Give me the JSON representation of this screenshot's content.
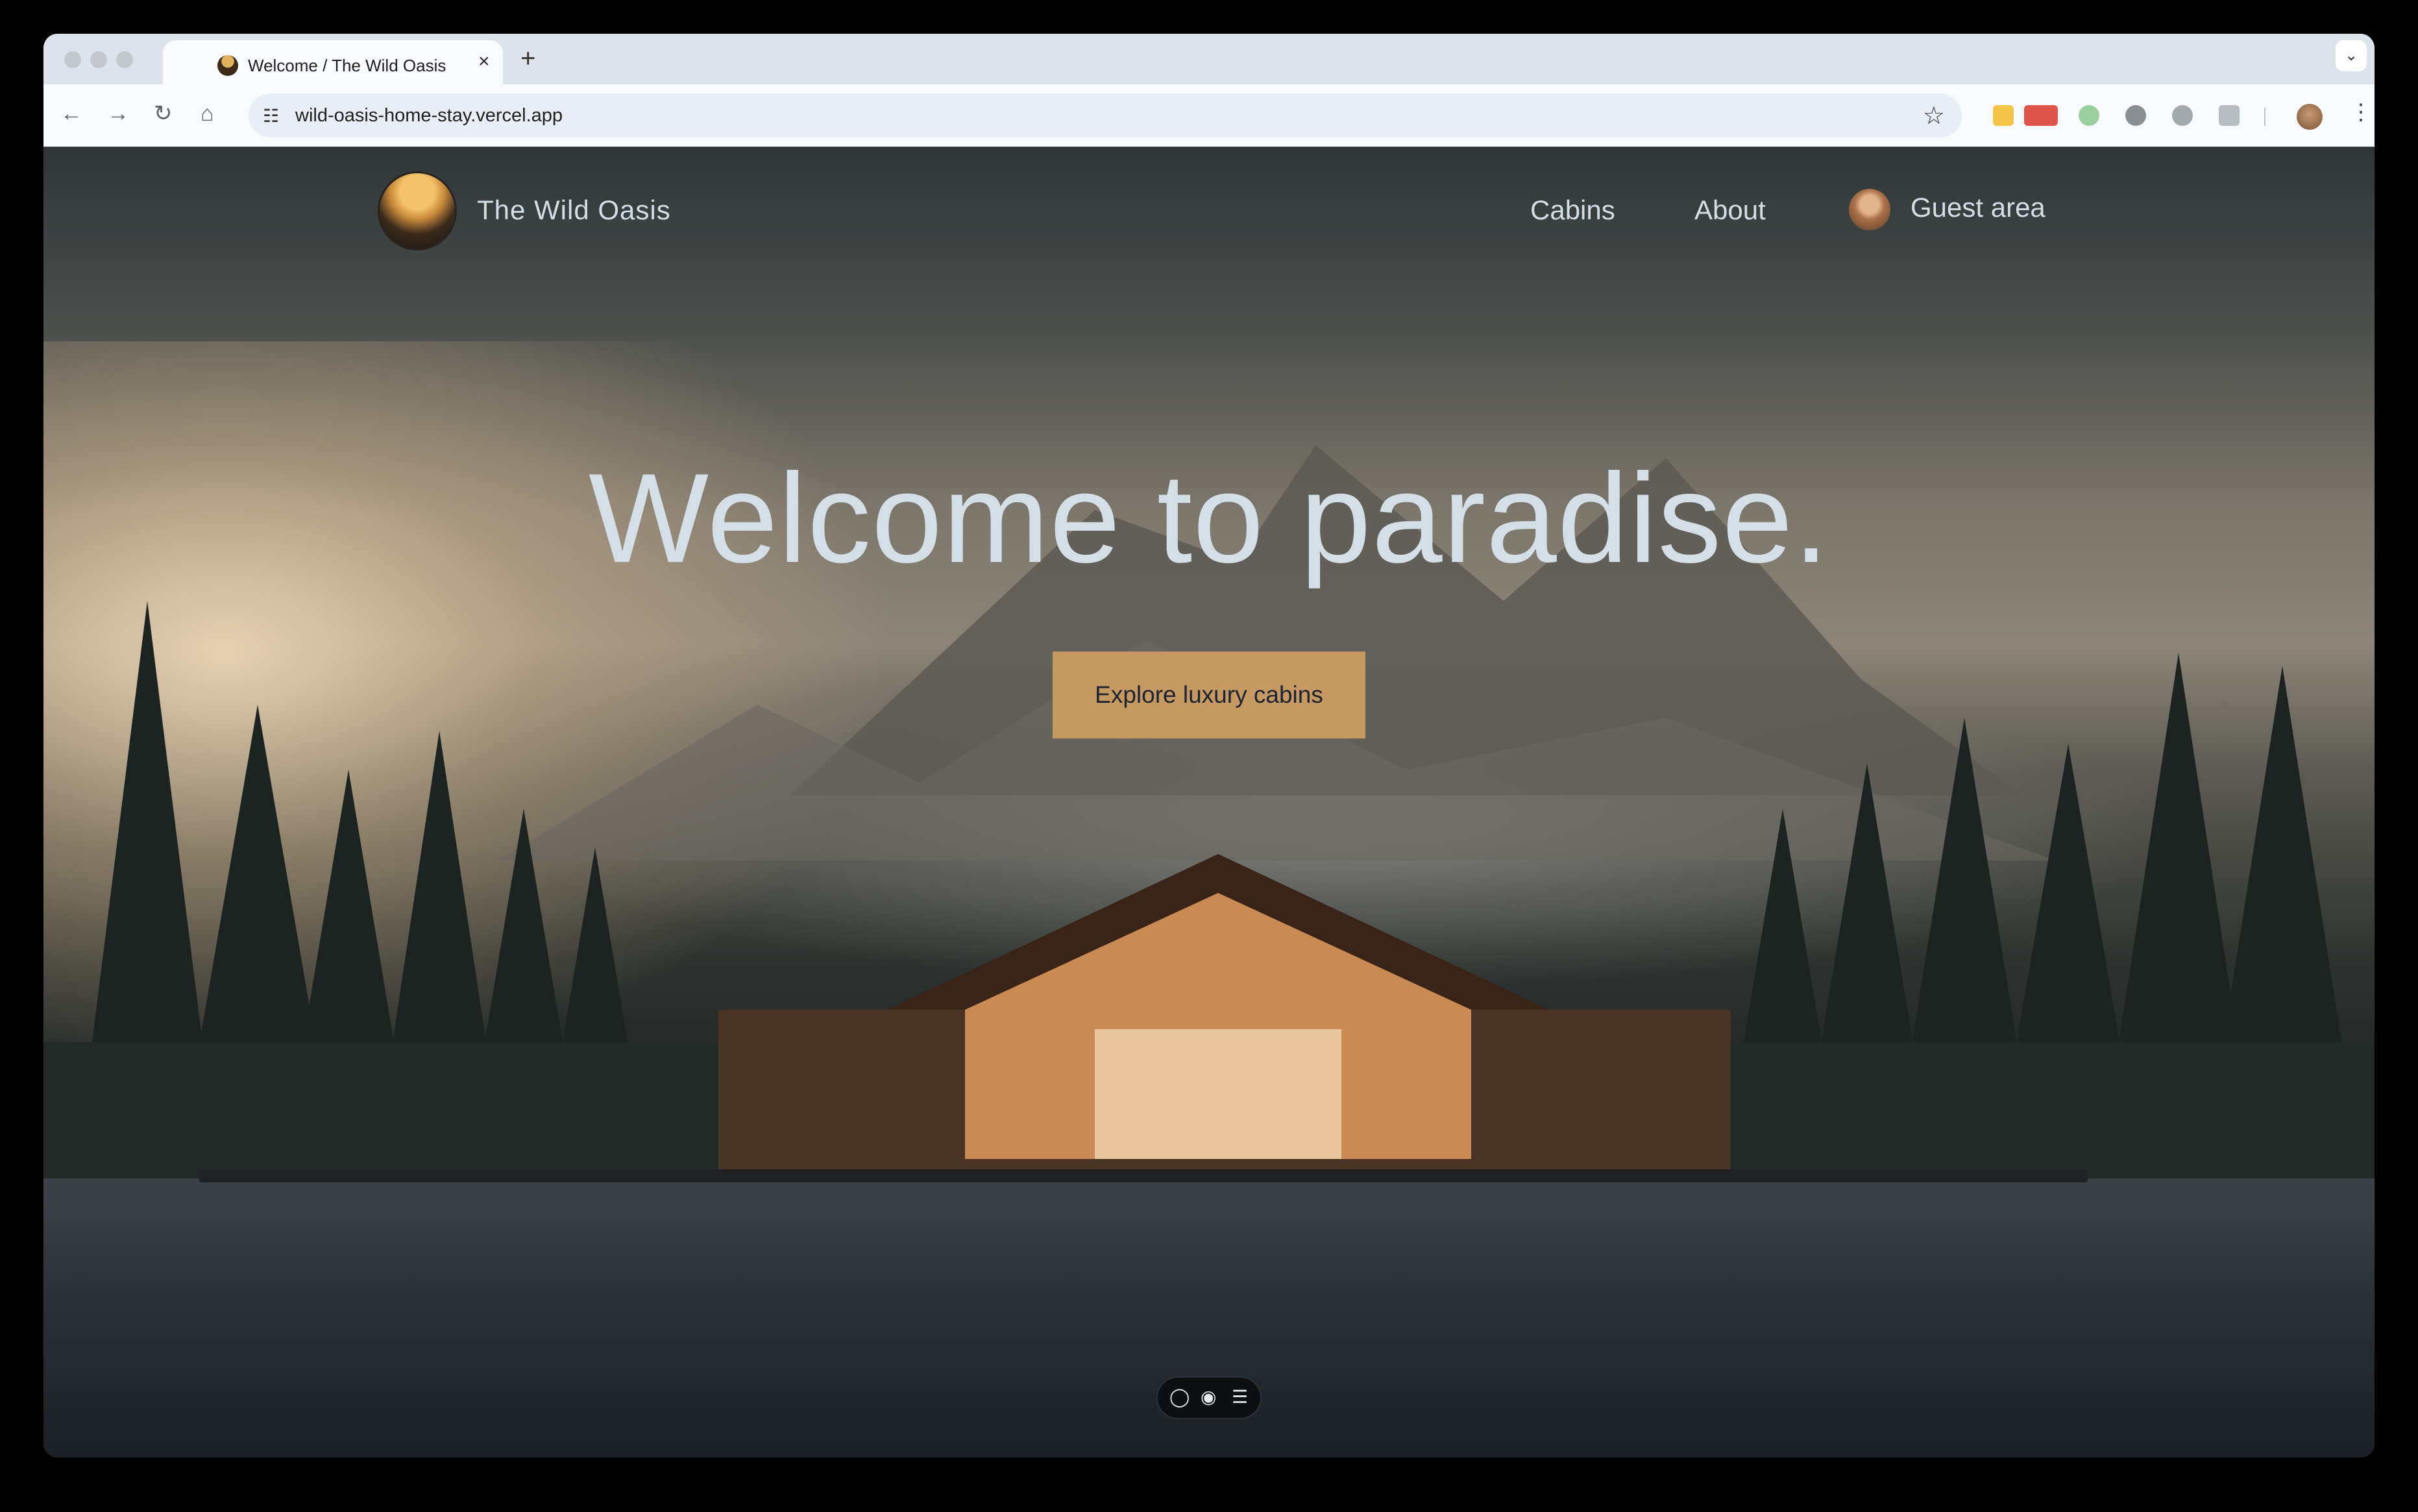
{
  "browser": {
    "tab_title": "Welcome / The Wild Oasis",
    "tab_close_icon": "×",
    "new_tab_icon": "+",
    "tab_menu_icon": "⌄",
    "url": "wild-oasis-home-stay.vercel.app",
    "back_icon": "←",
    "forward_icon": "→",
    "reload_icon": "↻",
    "home_icon": "⌂",
    "tune_icon": "☷",
    "star_icon": "☆",
    "menu_icon": "⋮"
  },
  "header": {
    "brand": "The Wild Oasis",
    "nav": {
      "cabins": "Cabins",
      "about": "About",
      "guest_area": "Guest area"
    }
  },
  "hero": {
    "title": "Welcome to paradise.",
    "cta_label": "Explore luxury cabins"
  },
  "floating_toolbar": {
    "comment_icon": "◯",
    "eye_icon": "◉",
    "list_icon": "☰"
  },
  "colors": {
    "accent": "#c69963",
    "text_light": "#d4dee7",
    "browser_chrome": "#dde3ea"
  }
}
